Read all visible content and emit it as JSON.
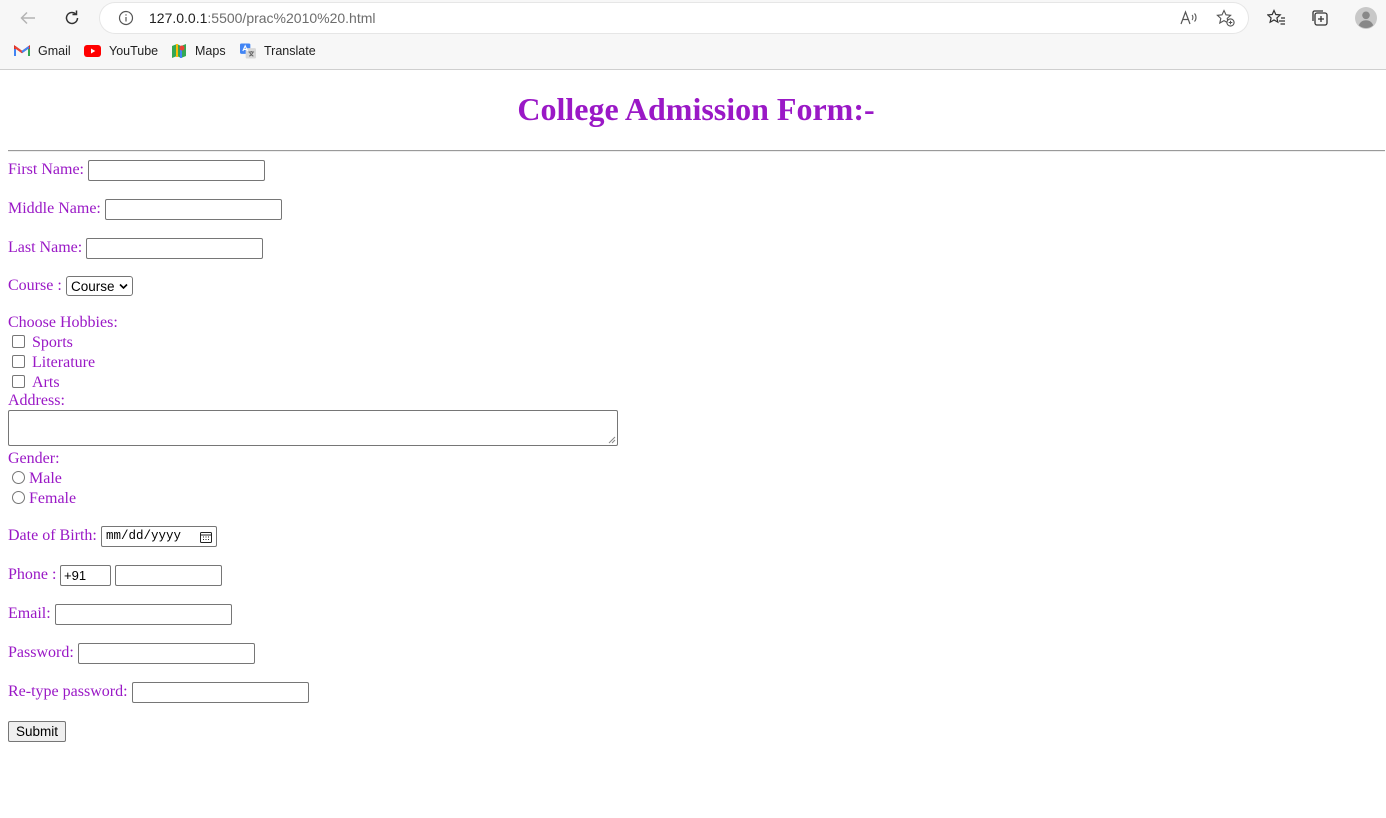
{
  "browser": {
    "url_host": "127.0.0.1",
    "url_rest": ":5500/prac%2010%20.html",
    "bookmarks": [
      {
        "label": "Gmail",
        "icon": "gmail-icon"
      },
      {
        "label": "YouTube",
        "icon": "youtube-icon"
      },
      {
        "label": "Maps",
        "icon": "maps-icon"
      },
      {
        "label": "Translate",
        "icon": "translate-icon"
      }
    ]
  },
  "form": {
    "title": "College Admission Form:-",
    "first_name_label": "First Name:",
    "middle_name_label": "Middle Name:",
    "last_name_label": "Last Name:",
    "course_label": "Course :",
    "course_selected": "Course",
    "hobbies_label": "Choose Hobbies:",
    "hobbies": [
      "Sports",
      "Literature",
      "Arts"
    ],
    "address_label": "Address:",
    "gender_label": "Gender:",
    "genders": [
      "Male",
      "Female"
    ],
    "dob_label": "Date of Birth:",
    "dob_placeholder": "mm/dd/yyyy",
    "phone_label": "Phone :",
    "phone_code": "+91",
    "email_label": "Email:",
    "password_label": "Password:",
    "retype_label": "Re-type password:",
    "submit_label": "Submit"
  },
  "colors": {
    "accent": "#9a18c6"
  }
}
